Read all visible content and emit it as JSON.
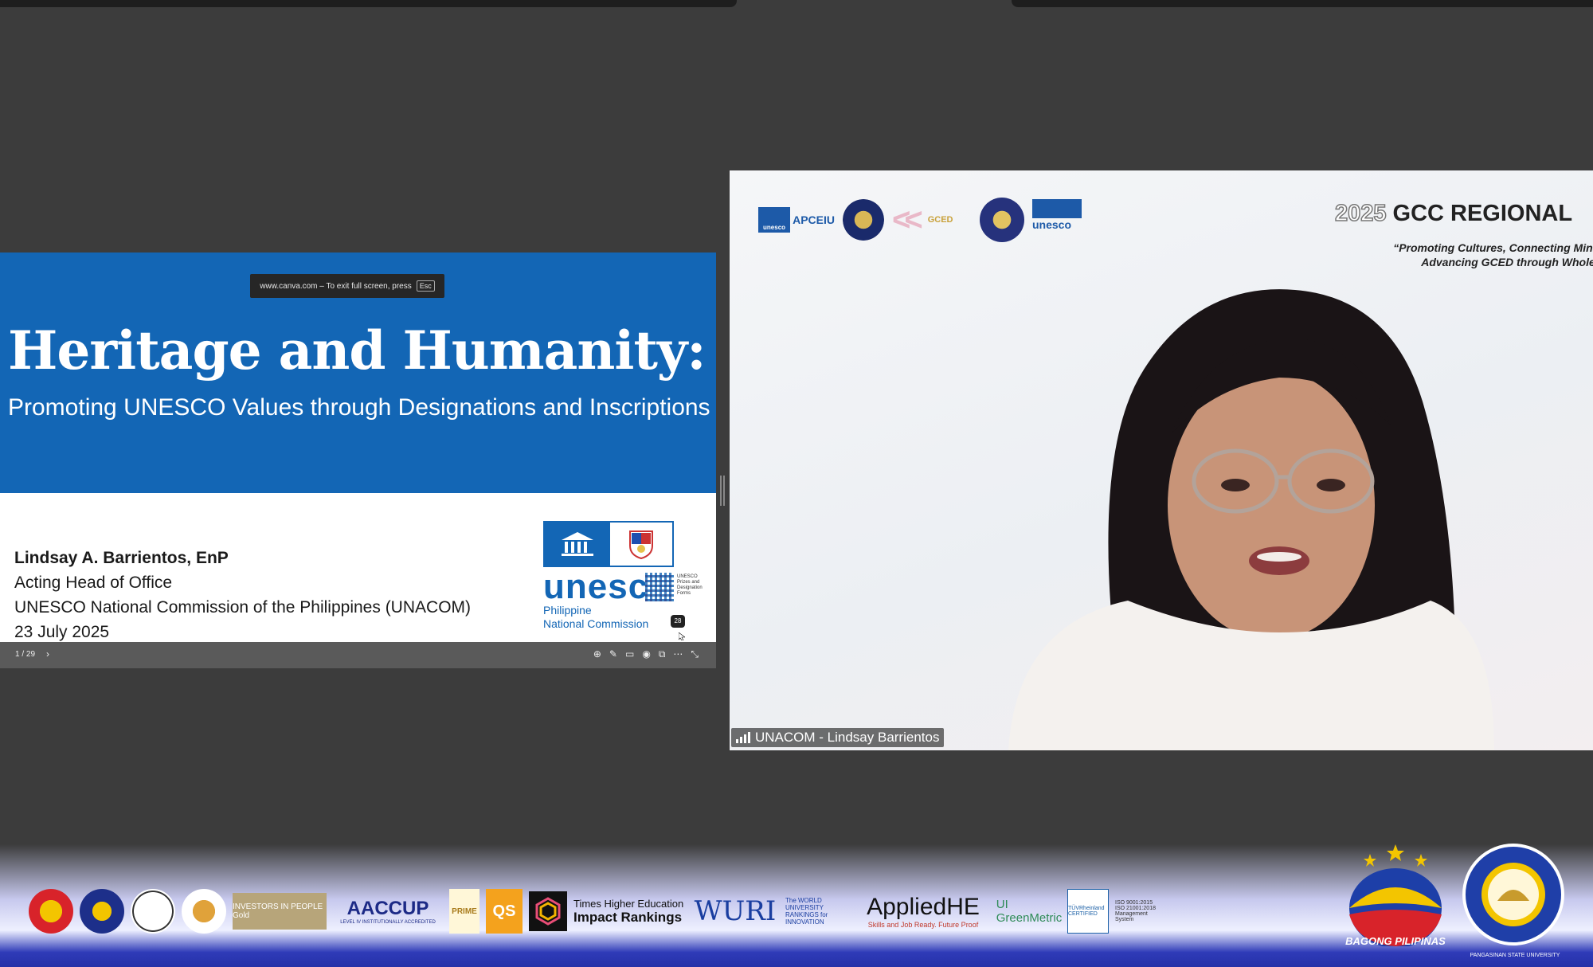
{
  "shared_screen": {
    "esc_notice": "www.canva.com – To exit full screen, press",
    "esc_key": "Esc",
    "title": "Heritage and Humanity:",
    "subtitle": "Promoting UNESCO Values through Designations and Inscriptions",
    "presenter": {
      "name": "Lindsay A. Barrientos, EnP",
      "role": "Acting Head of Office",
      "org": "UNESCO National Commission of the Philippines (UNACOM)",
      "date": "23 July 2025"
    },
    "unesco_logo": {
      "word": "unesco",
      "line1": "Philippine",
      "line2": "National Commission",
      "qr_caption": "UNESCO Prizes and Designation Forms"
    },
    "page_badge": "28",
    "toolbar": {
      "page_indicator": "1 / 29",
      "next_icon": "›"
    }
  },
  "video_tile": {
    "participant_name": "UNACOM - Lindsay Barrientos",
    "background": {
      "logo_apceiu": "APCEIU",
      "logo_unesco_small": "unesco",
      "logo_unesco": "unesco",
      "logo_gced": "GCED",
      "event_year": "2025",
      "event_title": "GCC REGIONAL",
      "event_tagline_1": "“Promoting Cultures, Connecting Minds",
      "event_tagline_2": "Advancing GCED through Whole S"
    }
  },
  "banner": {
    "investors": "INVESTORS IN PEOPLE Gold",
    "aaccup": "AACCUP",
    "aaccup_sub": "LEVEL IV INSTITUTIONALLY ACCREDITED",
    "prime": "PRIME",
    "qs": "QS",
    "the_line1": "Times Higher Education",
    "the_line2": "Impact Rankings",
    "wuri": "WURI",
    "wuri_text": "The WORLD UNIVERSITY RANKINGS for INNOVATION",
    "applied": "AppliedHE",
    "applied_sub": "Skills and Job Ready. Future Proof",
    "greenmetric": "UI GreenMetric",
    "tuv": "TÜVRheinland CERTIFIED",
    "iso": "ISO 9001:2015 ISO 21001:2018 Management System",
    "bagong_pilipinas": "BAGONG PILIPINAS",
    "psu": "PANGASINAN STATE UNIVERSITY"
  },
  "colors": {
    "slide_blue": "#1366b5",
    "background": "#3c3c3c",
    "banner_blue": "#2531a8"
  }
}
